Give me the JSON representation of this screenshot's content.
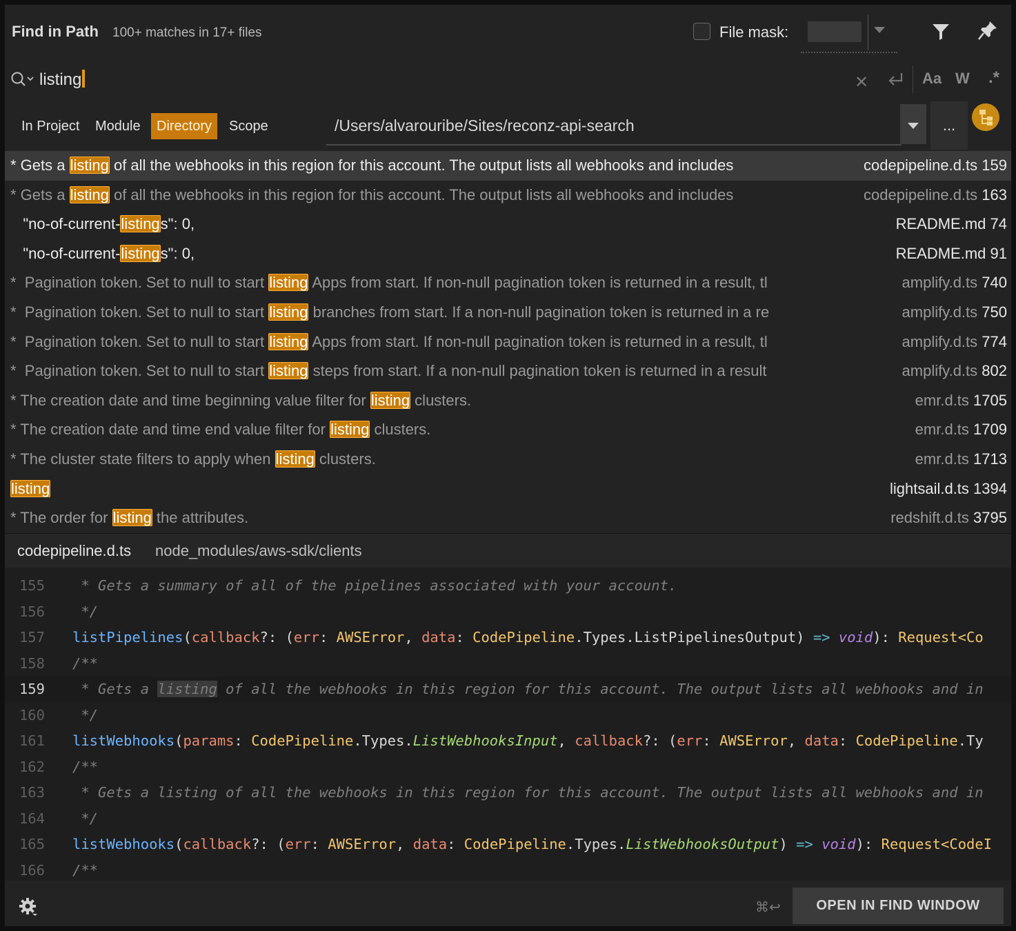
{
  "header": {
    "title": "Find in Path",
    "matches": "100+ matches in 17+ files",
    "file_mask_label": "File mask:",
    "file_mask_checked": false
  },
  "search": {
    "query": "listing",
    "case_label": "Aa",
    "word_label": "W",
    "regex_label": ".*"
  },
  "scope": {
    "tabs": [
      {
        "label": "In Project",
        "active": false
      },
      {
        "label": "Module",
        "active": false
      },
      {
        "label": "Directory",
        "active": true
      },
      {
        "label": "Scope",
        "active": false
      }
    ],
    "directory": "/Users/alvarouribe/Sites/reconz-api-search",
    "more_label": "..."
  },
  "results": [
    {
      "before": "* Gets a ",
      "match": "listing",
      "after": " of all the webhooks in this region for this account. The output lists all webhooks and includes",
      "file": "codepipeline.d.ts",
      "line": "159",
      "selected": true,
      "bright": true
    },
    {
      "before": "* Gets a ",
      "match": "listing",
      "after": " of all the webhooks in this region for this account. The output lists all webhooks and includes",
      "file": "codepipeline.d.ts",
      "line": "163",
      "selected": false,
      "bright": false
    },
    {
      "before": "   \"no-of-current-",
      "match": "listing",
      "after": "s\": 0,",
      "file": "README.md",
      "line": "74",
      "selected": false,
      "bright": true
    },
    {
      "before": "   \"no-of-current-",
      "match": "listing",
      "after": "s\": 0,",
      "file": "README.md",
      "line": "91",
      "selected": false,
      "bright": true
    },
    {
      "before": "*  Pagination token. Set to null to start ",
      "match": "listing",
      "after": " Apps from start. If non-null pagination token is returned in a result, tl",
      "file": "amplify.d.ts",
      "line": "740",
      "selected": false,
      "bright": false
    },
    {
      "before": "*  Pagination token. Set to null to start ",
      "match": "listing",
      "after": " branches from start. If a non-null pagination token is returned in a re",
      "file": "amplify.d.ts",
      "line": "750",
      "selected": false,
      "bright": false
    },
    {
      "before": "*  Pagination token. Set to null to start ",
      "match": "listing",
      "after": " Apps from start. If non-null pagination token is returned in a result, tl",
      "file": "amplify.d.ts",
      "line": "774",
      "selected": false,
      "bright": false
    },
    {
      "before": "*  Pagination token. Set to null to start ",
      "match": "listing",
      "after": " steps from start. If a non-null pagination token is returned in a result",
      "file": "amplify.d.ts",
      "line": "802",
      "selected": false,
      "bright": false
    },
    {
      "before": "* The creation date and time beginning value filter for ",
      "match": "listing",
      "after": " clusters.",
      "file": "emr.d.ts",
      "line": "1705",
      "selected": false,
      "bright": false
    },
    {
      "before": "* The creation date and time end value filter for ",
      "match": "listing",
      "after": " clusters.",
      "file": "emr.d.ts",
      "line": "1709",
      "selected": false,
      "bright": false
    },
    {
      "before": "* The cluster state filters to apply when ",
      "match": "listing",
      "after": " clusters.",
      "file": "emr.d.ts",
      "line": "1713",
      "selected": false,
      "bright": false
    },
    {
      "before": "",
      "match": "listing",
      "after": "",
      "file": "lightsail.d.ts",
      "line": "1394",
      "selected": false,
      "bright": true
    },
    {
      "before": "* The order for ",
      "match": "listing",
      "after": " the attributes.",
      "file": "redshift.d.ts",
      "line": "3795",
      "selected": false,
      "bright": false
    }
  ],
  "preview": {
    "file": "codepipeline.d.ts",
    "path": "node_modules/aws-sdk/clients",
    "current_line": "159",
    "lines": [
      {
        "n": "155",
        "t": [
          [
            "cm",
            " * Gets a summary of all of the pipelines associated with your account."
          ]
        ]
      },
      {
        "n": "156",
        "t": [
          [
            "cm",
            " */"
          ]
        ]
      },
      {
        "n": "157",
        "t": [
          [
            "fn",
            "listPipelines"
          ],
          [
            "pu",
            "("
          ],
          [
            "pa",
            "callback"
          ],
          [
            "pu",
            "?: ("
          ],
          [
            "pa",
            "err"
          ],
          [
            "pu",
            ": "
          ],
          [
            "ty",
            "AWSError"
          ],
          [
            "pu",
            ", "
          ],
          [
            "pa",
            "data"
          ],
          [
            "pu",
            ": "
          ],
          [
            "ty",
            "CodePipeline"
          ],
          [
            "pu",
            "."
          ],
          [
            "wh",
            "Types"
          ],
          [
            "pu",
            "."
          ],
          [
            "wh",
            "ListPipelinesOutput"
          ],
          [
            "pu",
            ") "
          ],
          [
            "ar",
            "=>"
          ],
          [
            "pu",
            " "
          ],
          [
            "kw",
            "void"
          ],
          [
            "pu",
            "): "
          ],
          [
            "ty",
            "Request<Co"
          ]
        ]
      },
      {
        "n": "158",
        "t": [
          [
            "cm",
            "/**"
          ]
        ]
      },
      {
        "n": "159",
        "t": [
          [
            "cm",
            " * Gets a "
          ],
          [
            "cmh",
            "listing"
          ],
          [
            "cm",
            " of all the webhooks in this region for this account. The output lists all webhooks and in"
          ]
        ]
      },
      {
        "n": "160",
        "t": [
          [
            "cm",
            " */"
          ]
        ]
      },
      {
        "n": "161",
        "t": [
          [
            "fn",
            "listWebhooks"
          ],
          [
            "pu",
            "("
          ],
          [
            "pa",
            "params"
          ],
          [
            "pu",
            ": "
          ],
          [
            "ty",
            "CodePipeline"
          ],
          [
            "pu",
            "."
          ],
          [
            "wh",
            "Types"
          ],
          [
            "pu",
            "."
          ],
          [
            "it",
            "ListWebhooksInput"
          ],
          [
            "pu",
            ", "
          ],
          [
            "pa",
            "callback"
          ],
          [
            "pu",
            "?: ("
          ],
          [
            "pa",
            "err"
          ],
          [
            "pu",
            ": "
          ],
          [
            "ty",
            "AWSError"
          ],
          [
            "pu",
            ", "
          ],
          [
            "pa",
            "data"
          ],
          [
            "pu",
            ": "
          ],
          [
            "ty",
            "CodePipeline"
          ],
          [
            "pu",
            "."
          ],
          [
            "wh",
            "Ty"
          ]
        ]
      },
      {
        "n": "162",
        "t": [
          [
            "cm",
            "/**"
          ]
        ]
      },
      {
        "n": "163",
        "t": [
          [
            "cm",
            " * Gets a listing of all the webhooks in this region for this account. The output lists all webhooks and in"
          ]
        ]
      },
      {
        "n": "164",
        "t": [
          [
            "cm",
            " */"
          ]
        ]
      },
      {
        "n": "165",
        "t": [
          [
            "fn",
            "listWebhooks"
          ],
          [
            "pu",
            "("
          ],
          [
            "pa",
            "callback"
          ],
          [
            "pu",
            "?: ("
          ],
          [
            "pa",
            "err"
          ],
          [
            "pu",
            ": "
          ],
          [
            "ty",
            "AWSError"
          ],
          [
            "pu",
            ", "
          ],
          [
            "pa",
            "data"
          ],
          [
            "pu",
            ": "
          ],
          [
            "ty",
            "CodePipeline"
          ],
          [
            "pu",
            "."
          ],
          [
            "wh",
            "Types"
          ],
          [
            "pu",
            "."
          ],
          [
            "it",
            "ListWebhooksOutput"
          ],
          [
            "pu",
            ") "
          ],
          [
            "ar",
            "=>"
          ],
          [
            "pu",
            " "
          ],
          [
            "kw",
            "void"
          ],
          [
            "pu",
            "): "
          ],
          [
            "ty",
            "Request<CodeI"
          ]
        ]
      },
      {
        "n": "166",
        "t": [
          [
            "cm",
            "/**"
          ]
        ]
      }
    ]
  },
  "footer": {
    "shortcut": "⌘↩",
    "open_button": "OPEN IN FIND WINDOW"
  },
  "colors": {
    "highlight": "#c97d09",
    "background": "#232323",
    "selected_row": "#3a3a3a"
  }
}
